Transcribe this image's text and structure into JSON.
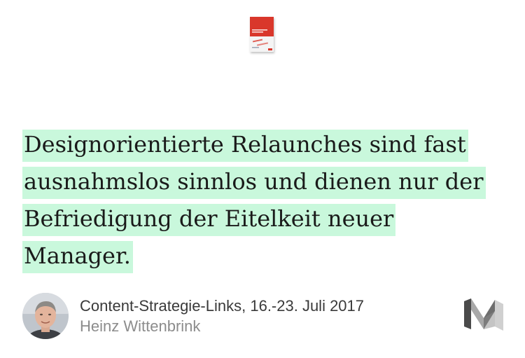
{
  "icon": {
    "book": "book-cover-icon",
    "avatar": "author-avatar",
    "logo": "medium-logo-icon"
  },
  "quote": {
    "lines": [
      "Designorientierte Relaunches sind fast",
      "ausnahmslos sinnlos und dienen nur der",
      "Befriedigung der Eitelkeit neuer Manager."
    ],
    "highlight_color": "#c9f8dc"
  },
  "footer": {
    "title": "Content-Strategie-Links, 16.-23. Juli 2017",
    "author": "Heinz Wittenbrink"
  },
  "colors": {
    "text": "#1a1a1a",
    "author": "#8c8c8c",
    "book_red": "#d9372b"
  }
}
